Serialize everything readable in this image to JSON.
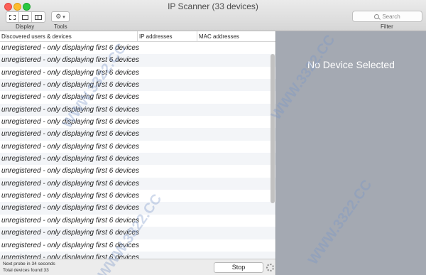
{
  "window": {
    "title": "IP Scanner (33 devices)"
  },
  "toolbar": {
    "display_label": "Display",
    "tools_label": "Tools",
    "filter_label": "Filter",
    "gear_glyph": "⚙",
    "chevron_glyph": "▾",
    "search_placeholder": "Search"
  },
  "table": {
    "columns": [
      "Discovered users & devices",
      "IP addresses",
      "MAC addresses"
    ],
    "rows": [
      "unregistered - only displaying first 6 devices",
      "unregistered - only displaying first 6 devices",
      "unregistered - only displaying first 6 devices",
      "unregistered - only displaying first 6 devices",
      "unregistered - only displaying first 6 devices",
      "unregistered - only displaying first 6 devices",
      "unregistered - only displaying first 6 devices",
      "unregistered - only displaying first 6 devices",
      "unregistered - only displaying first 6 devices",
      "unregistered - only displaying first 6 devices",
      "unregistered - only displaying first 6 devices",
      "unregistered - only displaying first 6 devices",
      "unregistered - only displaying first 6 devices",
      "unregistered - only displaying first 6 devices",
      "unregistered - only displaying first 6 devices",
      "unregistered - only displaying first 6 devices",
      "unregistered - only displaying first 6 devices",
      "unregistered - only displaying first 6 devices"
    ]
  },
  "detail": {
    "message": "No Device Selected"
  },
  "footer": {
    "next_probe": "Next probe in 34 seconds",
    "total_found": "Total devices found:33",
    "stop_label": "Stop"
  },
  "watermark": {
    "text": "WWW.3322.CC"
  },
  "colors": {
    "detail_bg": "#a4a9b2",
    "row_alt": "#f3f5f8"
  }
}
